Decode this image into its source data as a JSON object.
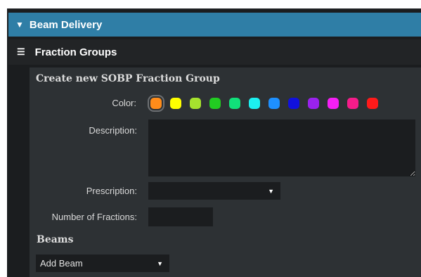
{
  "beam_delivery": {
    "title": "Beam Delivery",
    "toggle_icon": "triangle-down-icon"
  },
  "fraction_groups": {
    "title": "Fraction Groups",
    "menu_icon": "hamburger-menu-icon"
  },
  "form": {
    "title": "Create new SOBP Fraction Group",
    "color_label": "Color:",
    "colors": [
      "#ff8c1a",
      "#ffff00",
      "#a6e22e",
      "#22cc22",
      "#11e07a",
      "#1cf0f0",
      "#1e90ff",
      "#1111dd",
      "#9a22ee",
      "#f51ff5",
      "#f51c8a",
      "#ff1a1a"
    ],
    "selected_color_index": 0,
    "description_label": "Description:",
    "description_value": "",
    "prescription_label": "Prescription:",
    "prescription_value": "",
    "fractions_label": "Number of Fractions:",
    "fractions_value": "",
    "beams_title": "Beams",
    "add_beam_label": "Add Beam"
  }
}
